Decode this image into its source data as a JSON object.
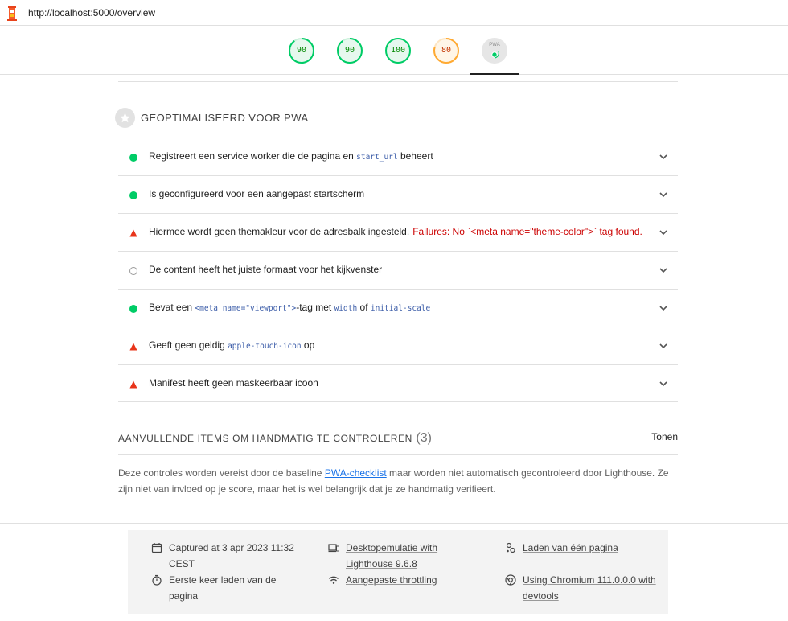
{
  "browser": {
    "url": "http://localhost:5000/overview",
    "logo_icon": "lighthouse-icon"
  },
  "gauges": [
    {
      "score": "90",
      "color": "#0c6"
    },
    {
      "score": "90",
      "color": "#0c6"
    },
    {
      "score": "100",
      "color": "#0c6"
    },
    {
      "score": "80",
      "color": "#fa3"
    },
    {
      "label": "PWA"
    }
  ],
  "group": {
    "icon": "star-icon",
    "title": "GEOPTIMALISEERD VOOR PWA",
    "audits": [
      {
        "status": "pass",
        "parts": [
          "Registreert een service worker die de pagina en ",
          "start_url",
          " beheert"
        ]
      },
      {
        "status": "pass",
        "parts": [
          "Is geconfigureerd voor een aangepast startscherm"
        ]
      },
      {
        "status": "fail",
        "parts": [
          "Hiermee wordt geen themakleur voor de adresbalk ingesteld."
        ],
        "failure": "Failures: No `<meta name=\"theme-color\">` tag found."
      },
      {
        "status": "na",
        "parts": [
          "De content heeft het juiste formaat voor het kijkvenster"
        ]
      },
      {
        "status": "pass",
        "parts": [
          "Bevat een ",
          "<meta name=\"viewport\">",
          "-tag met ",
          "width",
          " of ",
          "initial-scale"
        ]
      },
      {
        "status": "fail",
        "parts": [
          "Geeft geen geldig ",
          "apple-touch-icon",
          " op"
        ]
      },
      {
        "status": "fail",
        "parts": [
          "Manifest heeft geen maskeerbaar icoon"
        ]
      }
    ]
  },
  "manual": {
    "title": "AANVULLENDE ITEMS OM HANDMATIG TE CONTROLEREN",
    "count": "(3)",
    "toggle": "Tonen",
    "desc_before": "Deze controles worden vereist door de baseline ",
    "desc_link": "PWA-checklist",
    "desc_after": " maar worden niet automatisch gecontroleerd door Lighthouse. Ze zijn niet van invloed op je score, maar het is wel belangrijk dat je ze handmatig verifieert."
  },
  "footer": {
    "captured_line1": "Captured at 3 apr 2023 11:32",
    "captured_line2": "CEST",
    "first_load_line1": "Eerste keer laden van de",
    "first_load_line2": "pagina",
    "emulation_line1": "Desktopemulatie with",
    "emulation_line2": "Lighthouse 9.6.8",
    "throttling": "Aangepaste throttling",
    "single_page": "Laden van één pagina",
    "chromium_line1": "Using Chromium 111.0.0.0 with",
    "chromium_line2": "devtools"
  },
  "colors": {
    "pass": "#0c6",
    "fail": "#e8341a",
    "average": "#fa3"
  }
}
